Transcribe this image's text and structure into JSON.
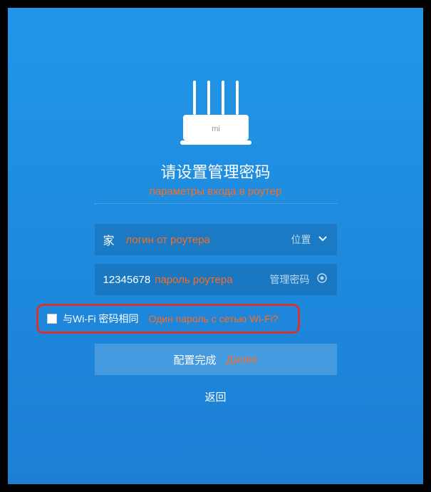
{
  "title": "请设置管理密码",
  "subtitle": "параметры входа в роутер",
  "login": {
    "icon": "家",
    "annotation": "логин от роутера",
    "right_label": "位置"
  },
  "password": {
    "value": "12345678",
    "annotation": "пароль роутера",
    "right_label": "管理密码"
  },
  "checkbox": {
    "label": "与Wi-Fi 密码相同",
    "annotation": "Один пароль с сетью Wi-Fi?"
  },
  "submit": {
    "label": "配置完成",
    "annotation": "Далее"
  },
  "back": "返回"
}
